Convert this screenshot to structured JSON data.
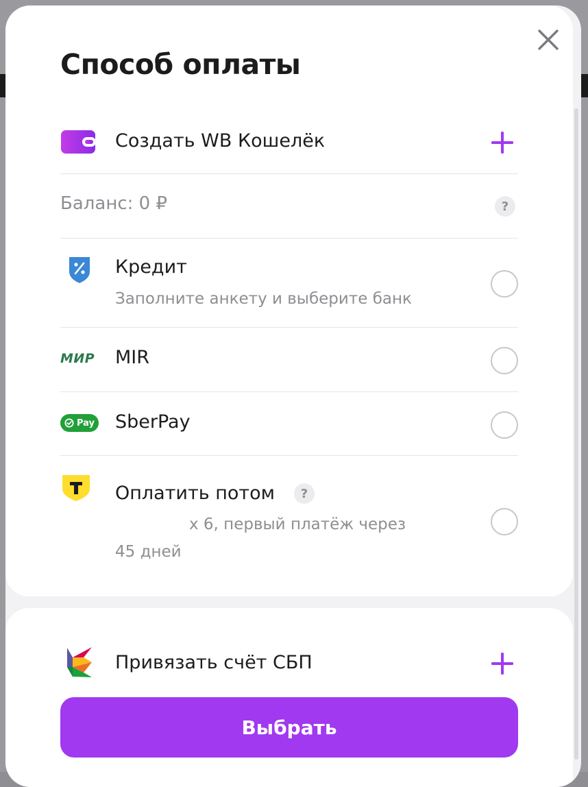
{
  "modal": {
    "title": "Способ оплаты",
    "close_icon": "close-icon"
  },
  "wallet": {
    "label": "Создать WB Кошелёк",
    "icon": "wallet-icon",
    "action_icon": "plus-icon"
  },
  "balance": {
    "label": "Баланс: 0 ₽",
    "help": "?"
  },
  "methods": [
    {
      "label": "Кредит",
      "sub": "Заполните анкету и выберите банк",
      "icon": "credit-shield-icon"
    },
    {
      "label": "MIR",
      "icon": "mir-logo-icon",
      "logo_text": "МИР"
    },
    {
      "label": "SberPay",
      "icon": "sberpay-logo-icon",
      "logo_text": "Pay"
    },
    {
      "label": "Оплатить потом",
      "help": "?",
      "sub_line1": "х 6, первый платёж через",
      "sub_line2": "45 дней",
      "icon": "tbank-logo-icon",
      "logo_text": "T"
    }
  ],
  "sbp": {
    "label": "Привязать счёт СБП",
    "icon": "sbp-logo-icon",
    "action_icon": "plus-icon"
  },
  "footer": {
    "select_label": "Выбрать"
  },
  "colors": {
    "accent": "#a139f0",
    "text": "#1c1c1e",
    "muted": "#8e8e93",
    "mir_green": "#2b7a4b",
    "sber_green": "#21a038",
    "tbank_yellow": "#ffdd2d"
  }
}
